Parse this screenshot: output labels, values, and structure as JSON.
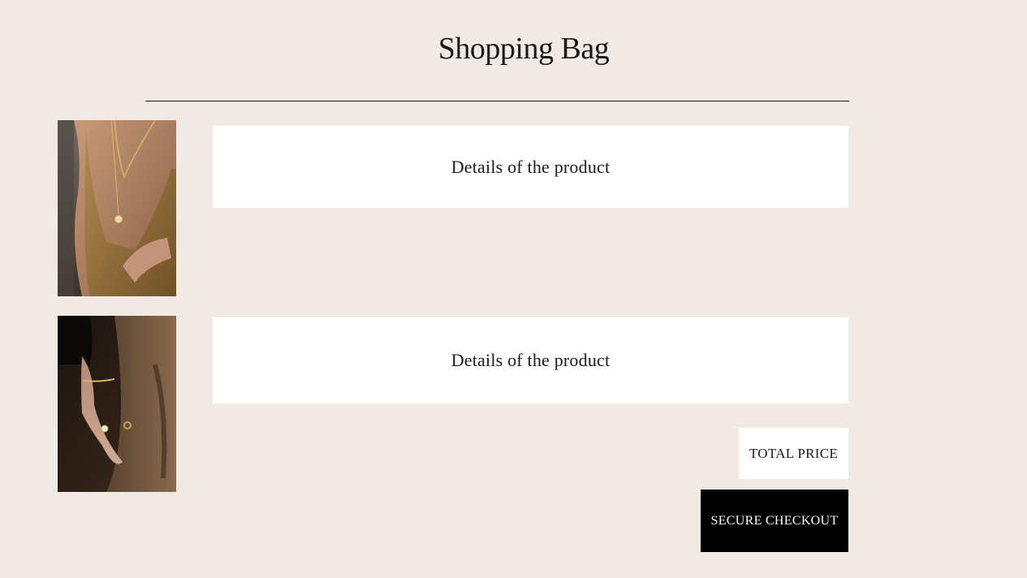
{
  "page": {
    "title": "Shopping Bag"
  },
  "cart": {
    "items": [
      {
        "image": "necklace-model-photo",
        "details_label": "Details of the product"
      },
      {
        "image": "bracelet-ring-hand-photo",
        "details_label": "Details of the product"
      }
    ],
    "total_label": "TOTAL PRICE",
    "checkout_label": "SECURE CHECKOUT"
  },
  "colors": {
    "background": "#f0e9e4",
    "card": "#ffffff",
    "text": "#1a1a1a",
    "button": "#000000",
    "button_text": "#ffffff"
  }
}
